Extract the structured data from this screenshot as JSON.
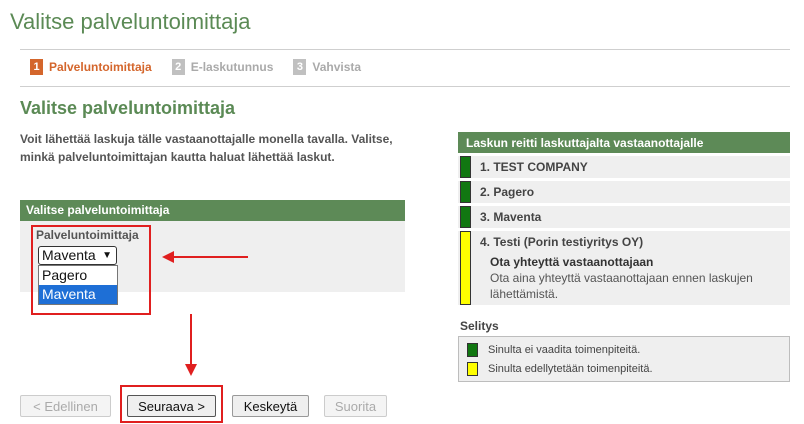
{
  "page": {
    "title": "Valitse palveluntoimittaja"
  },
  "steps": [
    {
      "num": "1",
      "label": "Palveluntoimittaja",
      "active": true
    },
    {
      "num": "2",
      "label": "E-laskutunnus",
      "active": false
    },
    {
      "num": "3",
      "label": "Vahvista",
      "active": false
    }
  ],
  "main": {
    "section_title": "Valitse palveluntoimittaja",
    "intro": "Voit lähettää laskuja tälle vastaanottajalle monella tavalla. Valitse, minkä palveluntoimittajan kautta haluat lähettää laskut.",
    "panel_header": "Valitse palveluntoimittaja",
    "field_label": "Palveluntoimittaja",
    "select_value": "Maventa",
    "options": [
      "Pagero",
      "Maventa"
    ]
  },
  "buttons": {
    "prev": "< Edellinen",
    "next": "Seuraava >",
    "cancel": "Keskeytä",
    "finish": "Suorita"
  },
  "route": {
    "header": "Laskun reitti laskuttajalta vastaanottajalle",
    "items": [
      {
        "name": "1. TEST COMPANY",
        "status": "green"
      },
      {
        "name": "2. Pagero",
        "status": "green"
      },
      {
        "name": "3. Maventa",
        "status": "green"
      },
      {
        "name": "4. Testi (Porin testiyritys OY)",
        "status": "yellow",
        "action_title": "Ota yhteyttä vastaanottajaan",
        "action_desc": "Ota aina yhteyttä vastaanottajaan ennen laskujen lähettämistä."
      }
    ]
  },
  "legend": {
    "title": "Selitys",
    "green_text": "Sinulta ei vaadita toimenpiteitä.",
    "yellow_text": "Sinulta edellytetään toimenpiteitä."
  },
  "colors": {
    "brand_green": "#5d8a57",
    "active_step": "#d4662c",
    "status_green": "#117711",
    "status_yellow": "#ffff00",
    "annotation_red": "#e01f1f"
  }
}
